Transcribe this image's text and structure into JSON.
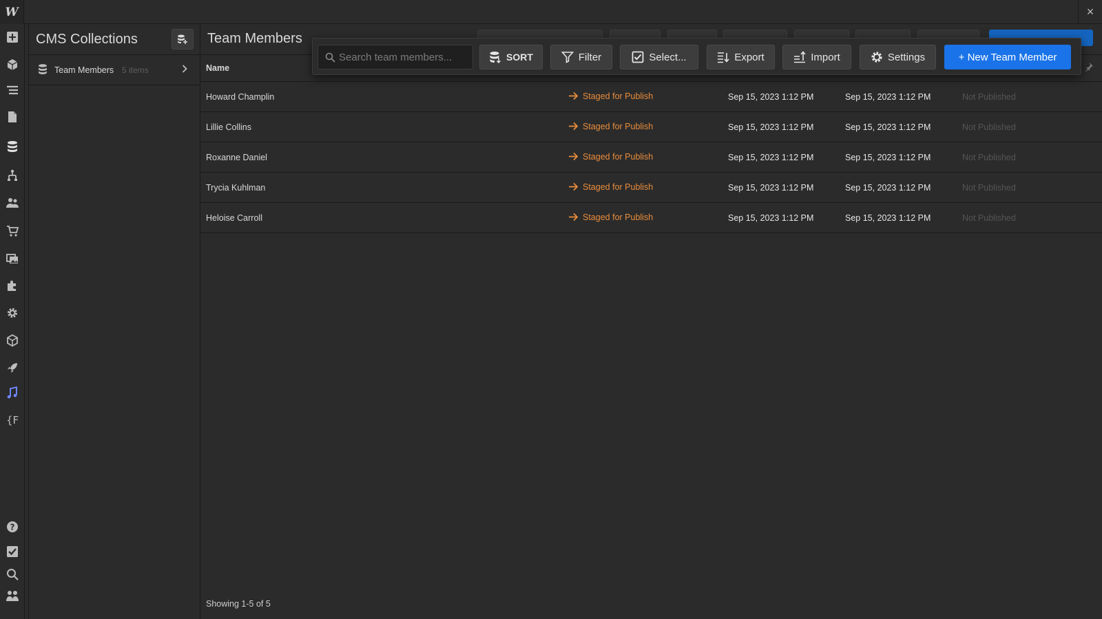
{
  "app": {
    "logo": "W",
    "close": "×"
  },
  "rail": {
    "icons": [
      "add-icon",
      "cube-icon",
      "navigator-icon",
      "pages-icon",
      "cms-icon",
      "logic-icon",
      "users-icon",
      "ecommerce-icon",
      "assets-icon",
      "apps-icon",
      "settings-icon",
      "library-icon",
      "rocket-icon",
      "audit-icon",
      "variables-icon",
      "help-icon",
      "tasks-icon",
      "search-icon",
      "collaborators-icon"
    ]
  },
  "collections": {
    "title": "CMS Collections",
    "items": [
      {
        "name": "Team Members",
        "count": "5 items"
      }
    ]
  },
  "main": {
    "title": "Team Members",
    "columns": {
      "name": "Name"
    },
    "rows": [
      {
        "name": "Howard Champlin",
        "status": "Staged for Publish",
        "created": "Sep 15, 2023 1:12 PM",
        "updated": "Sep 15, 2023 1:12 PM",
        "published": "Not Published"
      },
      {
        "name": "Lillie Collins",
        "status": "Staged for Publish",
        "created": "Sep 15, 2023 1:12 PM",
        "updated": "Sep 15, 2023 1:12 PM",
        "published": "Not Published"
      },
      {
        "name": "Roxanne Daniel",
        "status": "Staged for Publish",
        "created": "Sep 15, 2023 1:12 PM",
        "updated": "Sep 15, 2023 1:12 PM",
        "published": "Not Published"
      },
      {
        "name": "Trycia Kuhlman",
        "status": "Staged for Publish",
        "created": "Sep 15, 2023 1:12 PM",
        "updated": "Sep 15, 2023 1:12 PM",
        "published": "Not Published"
      },
      {
        "name": "Heloise Carroll",
        "status": "Staged for Publish",
        "created": "Sep 15, 2023 1:12 PM",
        "updated": "Sep 15, 2023 1:12 PM",
        "published": "Not Published"
      }
    ],
    "footer": "Showing 1-5 of 5"
  },
  "toolbar": {
    "search_placeholder": "Search team members...",
    "sort": "SORT",
    "filter": "Filter",
    "select": "Select...",
    "export": "Export",
    "import": "Import",
    "settings": "Settings",
    "new_item": "+ New Team Member"
  },
  "colors": {
    "status": "#ea8d3c",
    "primary": "#1a73e8"
  }
}
